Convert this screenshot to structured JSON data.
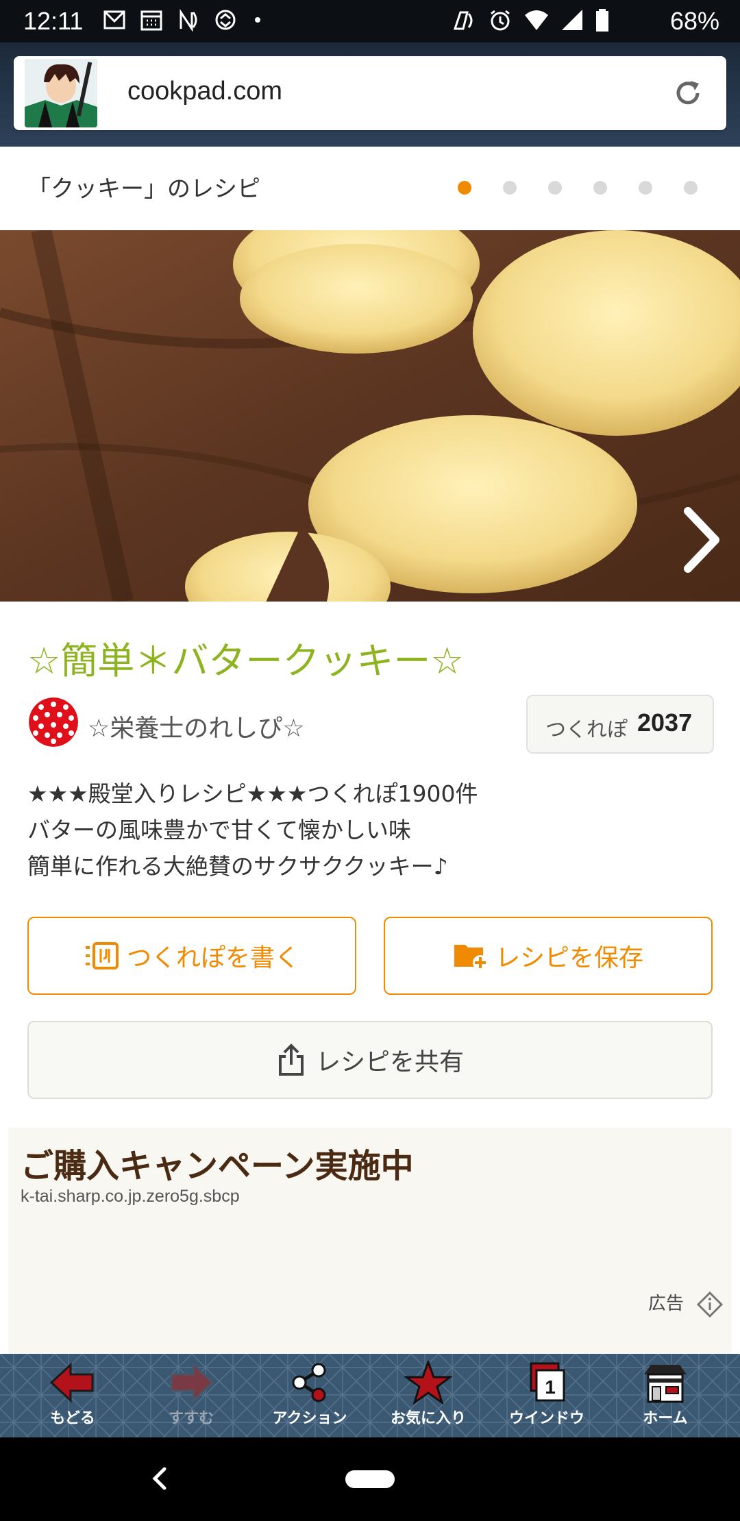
{
  "status_bar": {
    "time": "12:11",
    "battery": "68%",
    "left_icons": [
      "notification-icon",
      "calendar-icon",
      "nfc-icon",
      "sync-icon",
      "dot-icon"
    ],
    "right_icons": [
      "nfc-icon",
      "alarm-icon",
      "wifi-icon",
      "signal-icon",
      "battery-icon"
    ]
  },
  "browser": {
    "url": "cookpad.com",
    "reload_icon": "reload-icon"
  },
  "list": {
    "title": "「クッキー」のレシピ",
    "pages": 6,
    "active_page": 1
  },
  "recipe": {
    "title": "☆簡単＊バタークッキー☆",
    "author": "☆栄養士のれしぴ☆",
    "tsukurepo_label": "つくれぽ",
    "tsukurepo_count": "2037",
    "description": [
      "★★★殿堂入りレシピ★★★つくれぽ1900件",
      "バターの風味豊かで甘くて懐かしい味",
      "簡単に作れる大絶賛のサクサククッキー♪"
    ]
  },
  "actions": {
    "write_report": "つくれぽを書く",
    "save_recipe": "レシピを保存",
    "share_recipe": "レシピを共有"
  },
  "ad": {
    "title": "ご購入キャンペーン実施中",
    "url": "k-tai.sharp.co.jp.zero5g.sbcp",
    "label": "広告"
  },
  "toolbar": {
    "items": [
      {
        "label": "もどる",
        "icon": "back-arrow-icon"
      },
      {
        "label": "すすむ",
        "icon": "forward-arrow-icon"
      },
      {
        "label": "アクション",
        "icon": "share-nodes-icon"
      },
      {
        "label": "お気に入り",
        "icon": "star-icon"
      },
      {
        "label": "ウインドウ",
        "icon": "windows-icon",
        "count": "1"
      },
      {
        "label": "ホーム",
        "icon": "home-icon"
      }
    ]
  },
  "colors": {
    "accent_orange": "#f08a00",
    "title_green": "#8db320",
    "toolbar_bg": "#3b5873"
  }
}
